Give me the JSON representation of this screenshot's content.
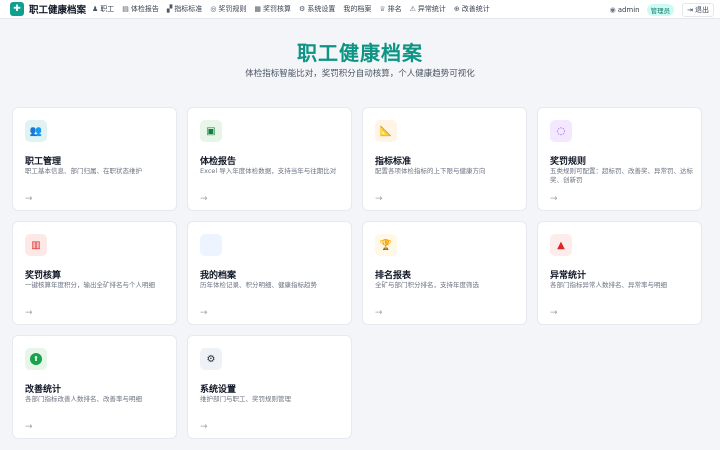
{
  "app": {
    "title": "职工健康档案",
    "logo_glyph": "✚"
  },
  "nav": [
    {
      "label": "职工",
      "icon": "users-icon",
      "glyph": "♟"
    },
    {
      "label": "体检报告",
      "icon": "report-icon",
      "glyph": "▤"
    },
    {
      "label": "指标标准",
      "icon": "ruler-icon",
      "glyph": "▞"
    },
    {
      "label": "奖罚规则",
      "icon": "lightbulb-icon",
      "glyph": "◎"
    },
    {
      "label": "奖罚核算",
      "icon": "calculator-icon",
      "glyph": "▦"
    },
    {
      "label": "系统设置",
      "icon": "gear-icon",
      "glyph": "⚙"
    },
    {
      "label": "我的档案",
      "icon": "",
      "glyph": ""
    },
    {
      "label": "排名",
      "icon": "trophy-icon",
      "glyph": "♕"
    },
    {
      "label": "异常统计",
      "icon": "warning-icon",
      "glyph": "⚠"
    },
    {
      "label": "改善统计",
      "icon": "arrow-up-icon",
      "glyph": "⊕"
    }
  ],
  "user": {
    "name": "admin",
    "role": "管理员",
    "logout_label": "退出",
    "user_glyph": "◉",
    "logout_glyph": "⇥"
  },
  "hero": {
    "title": "职工健康档案",
    "subtitle": "体检指标智能比对，奖罚积分自动核算，个人健康趋势可视化"
  },
  "colors": {
    "accent": "#0e9485"
  },
  "cards": [
    {
      "title": "职工管理",
      "desc": "职工基本信息、部门归属、在职状态维护",
      "icon": "users-icon",
      "glyph": "👥",
      "icon_color": "#0f766e",
      "icon_bg": "#e0f2f1",
      "arrow": "→"
    },
    {
      "title": "体检报告",
      "desc": "Excel 导入年度体检数据，支持当年与往期比对",
      "icon": "clipboard-icon",
      "glyph": "▣",
      "icon_color": "#15803d",
      "icon_bg": "#e8f5e9",
      "arrow": "→"
    },
    {
      "title": "指标标准",
      "desc": "配置各项体检指标的上下限与健康方向",
      "icon": "ruler-icon",
      "glyph": "📐",
      "icon_color": "#b45309",
      "icon_bg": "#fff4e5",
      "arrow": "→"
    },
    {
      "title": "奖罚规则",
      "desc": "五类规则可配置：超标罚、改善奖、异常罚、达标奖、创新罚",
      "icon": "lightbulb-icon",
      "glyph": "◌",
      "icon_color": "#7c3aed",
      "icon_bg": "#f3e8ff",
      "arrow": "→"
    },
    {
      "title": "奖罚核算",
      "desc": "一键核算年度积分，输出全矿排名与个人明细",
      "icon": "calculator-icon",
      "glyph": "▥",
      "icon_color": "#dc2626",
      "icon_bg": "#fde8e8",
      "arrow": "→"
    },
    {
      "title": "我的档案",
      "desc": "历年体检记录、积分明细、健康指标趋势",
      "icon": "profile-icon",
      "glyph": "",
      "icon_color": "#2563eb",
      "icon_bg": "#eef4ff",
      "arrow": "→"
    },
    {
      "title": "排名报表",
      "desc": "全矿与部门积分排名，支持年度筛选",
      "icon": "trophy-icon",
      "glyph": "🏆",
      "icon_color": "#d97706",
      "icon_bg": "#fff8e6",
      "arrow": "→"
    },
    {
      "title": "异常统计",
      "desc": "各部门指标异常人数排名、异常率与明细",
      "icon": "warning-icon",
      "glyph": "▲",
      "icon_color": "#dc2626",
      "icon_bg": "#fdecec",
      "arrow": "→"
    },
    {
      "title": "改善统计",
      "desc": "各部门指标改善人数排名、改善率与明细",
      "icon": "arrow-up-circle-icon",
      "glyph": "⬆",
      "icon_color": "#ffffff",
      "icon_bg": "#e8f5e9",
      "arrow": "→"
    },
    {
      "title": "系统设置",
      "desc": "维护部门与职工、奖罚规则管理",
      "icon": "gear-icon",
      "glyph": "⚙",
      "icon_color": "#1f2937",
      "icon_bg": "#eef1f5",
      "arrow": "→"
    }
  ]
}
